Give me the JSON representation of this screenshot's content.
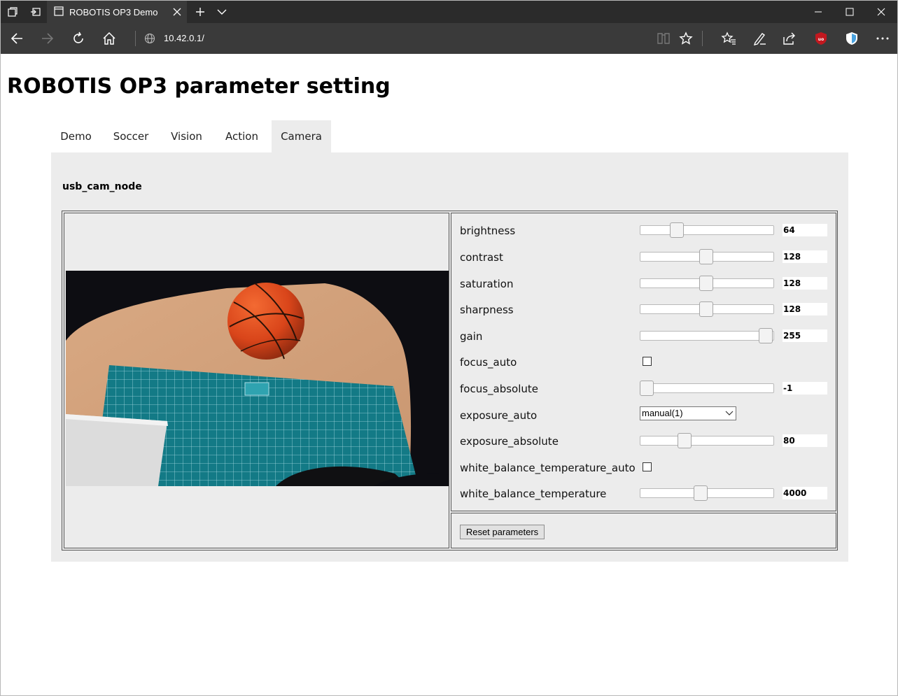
{
  "browser": {
    "tab_title": "ROBOTIS OP3 Demo",
    "url": "10.42.0.1/"
  },
  "page": {
    "title": "ROBOTIS OP3 parameter setting",
    "tabs": [
      {
        "label": "Demo"
      },
      {
        "label": "Soccer"
      },
      {
        "label": "Vision"
      },
      {
        "label": "Action"
      },
      {
        "label": "Camera"
      }
    ],
    "active_tab": "Camera",
    "node_name": "usb_cam_node",
    "params": [
      {
        "label": "brightness",
        "type": "slider",
        "value": "64",
        "fraction": 0.25
      },
      {
        "label": "contrast",
        "type": "slider",
        "value": "128",
        "fraction": 0.5
      },
      {
        "label": "saturation",
        "type": "slider",
        "value": "128",
        "fraction": 0.5
      },
      {
        "label": "sharpness",
        "type": "slider",
        "value": "128",
        "fraction": 0.5
      },
      {
        "label": "gain",
        "type": "slider",
        "value": "255",
        "fraction": 1.0
      },
      {
        "label": "focus_auto",
        "type": "checkbox",
        "checked": false
      },
      {
        "label": "focus_absolute",
        "type": "slider",
        "value": "-1",
        "fraction": 0.0
      },
      {
        "label": "exposure_auto",
        "type": "select",
        "value": "manual(1)"
      },
      {
        "label": "exposure_absolute",
        "type": "slider",
        "value": "80",
        "fraction": 0.32
      },
      {
        "label": "white_balance_temperature_auto",
        "type": "checkbox",
        "checked": false
      },
      {
        "label": "white_balance_temperature",
        "type": "slider",
        "value": "4000",
        "fraction": 0.45
      }
    ],
    "reset_label": "Reset parameters"
  },
  "colors": {
    "chrome_dark": "#2b2b2b",
    "chrome_toolbar": "#3a3a3a",
    "panel_bg": "#ececec",
    "ublock_red": "#c2181f",
    "shield_blue": "#4aa3e0"
  }
}
